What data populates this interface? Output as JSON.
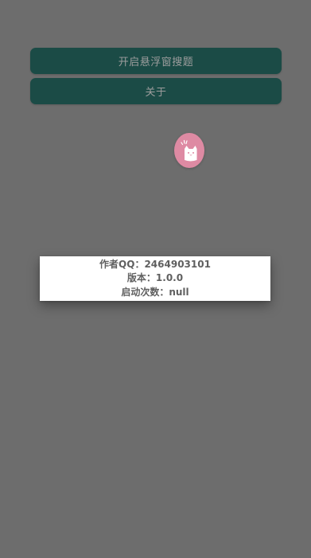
{
  "buttons": {
    "floating_search": "开启悬浮窗搜题",
    "about": "关于"
  },
  "floating_ball": {
    "icon": "cat-icon",
    "color": "#de8aa3"
  },
  "about_dialog": {
    "author_qq": "作者QQ：2464903101",
    "version": "版本：1.0.0",
    "launch_count": "启动次数：null"
  },
  "colors": {
    "background": "#6d6d6d",
    "button_bg": "#1b4b46",
    "button_text": "#9d9d9d"
  }
}
